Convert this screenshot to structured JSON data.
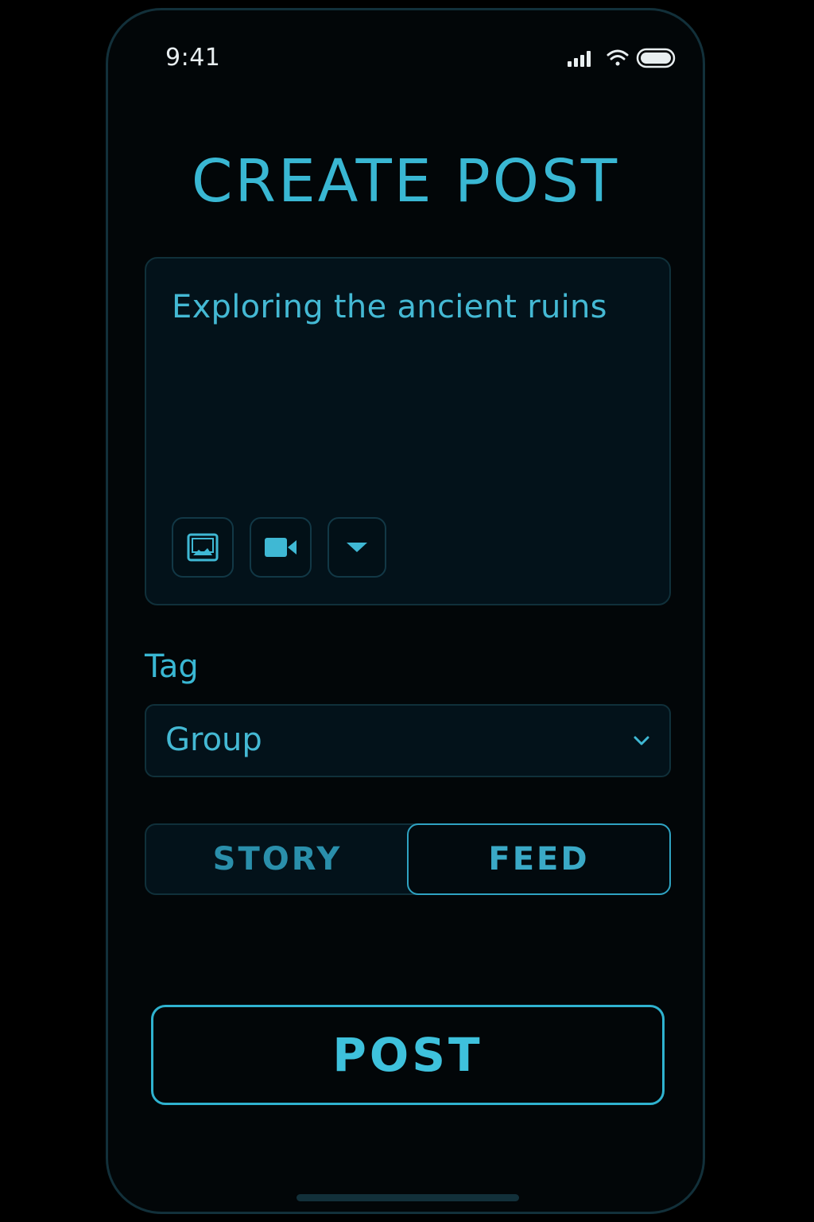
{
  "status_bar": {
    "time": "9:41",
    "icons": [
      "signal-icon",
      "wifi-icon",
      "battery-icon"
    ]
  },
  "header": {
    "title": "CREATE POST"
  },
  "composer": {
    "text": "Exploring the ancient ruins",
    "tools": [
      {
        "name": "image-icon"
      },
      {
        "name": "video-icon"
      },
      {
        "name": "dropdown-icon"
      }
    ]
  },
  "tag": {
    "label": "Tag",
    "selected": "Group"
  },
  "post_type": {
    "options": [
      "STORY",
      "FEED"
    ],
    "selected": "FEED"
  },
  "actions": {
    "post_label": "POST"
  },
  "colors": {
    "accent": "#39b7d3",
    "background": "#000000",
    "panel": "#03121a",
    "border": "#10303a"
  }
}
